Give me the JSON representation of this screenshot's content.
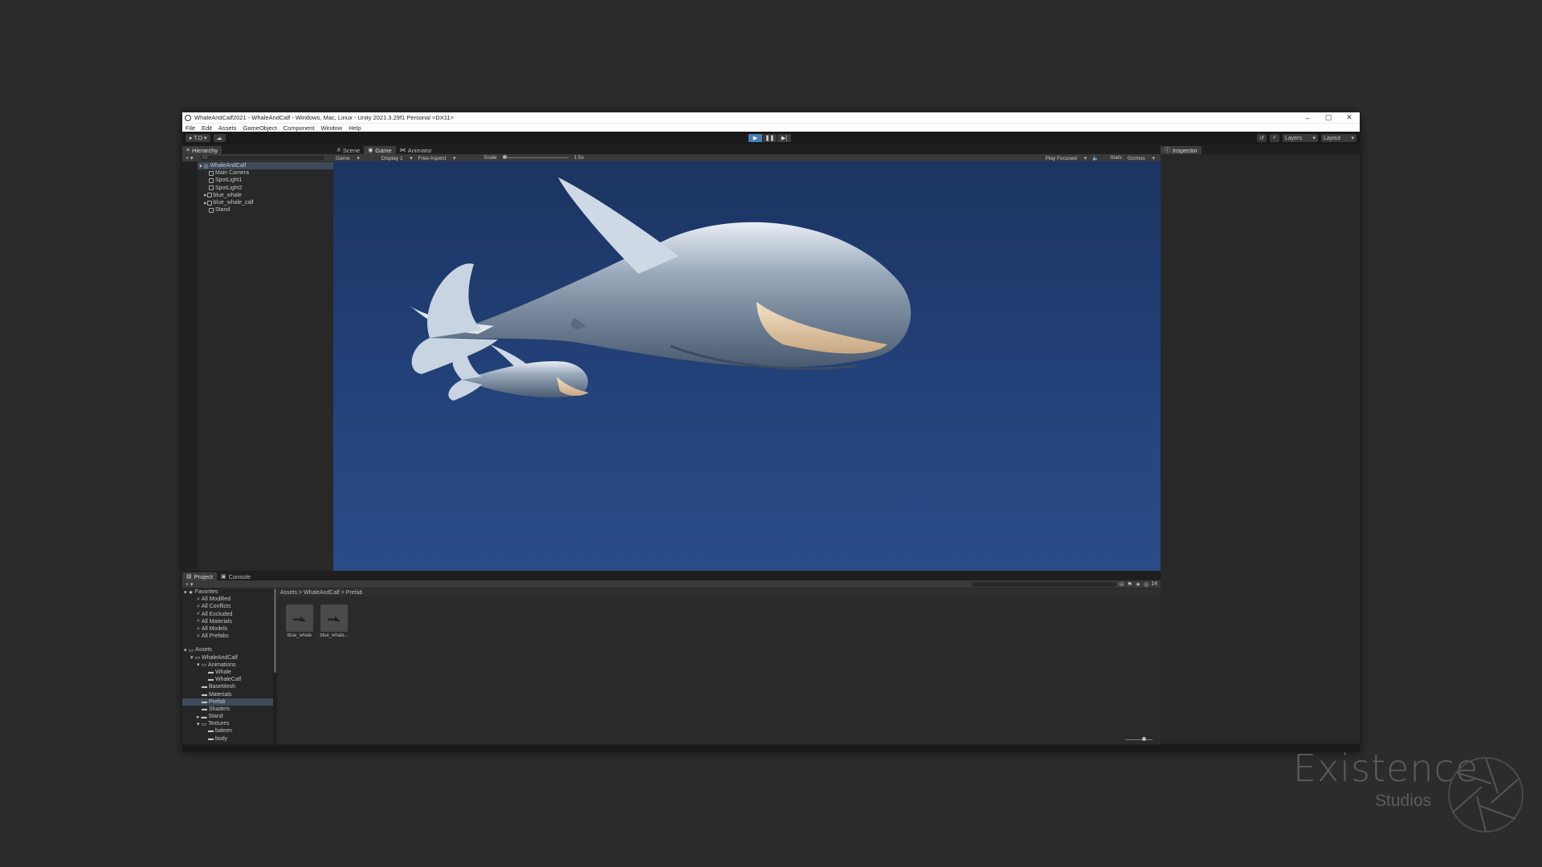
{
  "window": {
    "title": "WhaleAndCalf2021 - WhaleAndCalf - Windows, Mac, Linux - Unity 2021.3.29f1 Personal <DX11>",
    "controls": [
      "–",
      "▢",
      "✕"
    ]
  },
  "menu": [
    "File",
    "Edit",
    "Assets",
    "GameObject",
    "Component",
    "Window",
    "Help"
  ],
  "toolbar": {
    "account": "T.O",
    "layers": "Layers",
    "layout": "Layout"
  },
  "hierarchy": {
    "tab": "Hierarchy",
    "search_placeholder": "All",
    "items": [
      {
        "label": "WhaleAndCalf"
      },
      {
        "label": "Main Camera"
      },
      {
        "label": "SpotLight1"
      },
      {
        "label": "SpotLight2"
      },
      {
        "label": "blue_whale"
      },
      {
        "label": "blue_whale_calf"
      },
      {
        "label": "Stand"
      }
    ]
  },
  "center": {
    "tabs": [
      "Scene",
      "Game",
      "Animator"
    ],
    "game_bar": {
      "mode": "Game",
      "display": "Display 1",
      "aspect": "Free Aspect",
      "scale_label": "Scale",
      "scale_value": "1.5x",
      "play_focused": "Play Focused",
      "stats": "Stats",
      "gizmos": "Gizmos"
    }
  },
  "inspector": {
    "tab": "Inspector"
  },
  "project": {
    "tabs": [
      "Project",
      "Console"
    ],
    "favorites_label": "Favorites",
    "favorites": [
      "All Modified",
      "All Conflicts",
      "All Excluded",
      "All Materials",
      "All Models",
      "All Prefabs"
    ],
    "assets_label": "Assets",
    "folders": [
      "WhaleAndCalf",
      "Animations",
      "Whale",
      "WhaleCalf",
      "BaseMesh",
      "Materials",
      "Prefab",
      "Shaders",
      "Stand",
      "Textures",
      "baleen",
      "body"
    ],
    "breadcrumb": [
      "Assets",
      "WhaleAndCalf",
      "Prefab"
    ],
    "assets": [
      "blue_whale",
      "blue_whale..."
    ],
    "count": "14"
  },
  "watermark": {
    "title": "Existence",
    "subtitle": "Studios"
  }
}
